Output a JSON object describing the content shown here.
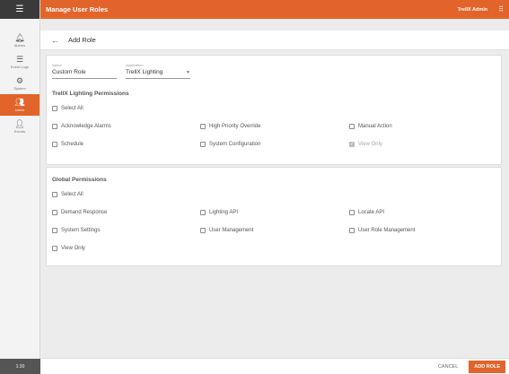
{
  "app": {
    "title": "Manage User Roles",
    "user": "TrellX Admin"
  },
  "sidebar": {
    "items": [
      {
        "label": "Alarms",
        "icon": "bell-icon"
      },
      {
        "label": "Event Logs",
        "icon": "list-icon"
      },
      {
        "label": "System",
        "icon": "gear-icon"
      },
      {
        "label": "Users",
        "icon": "users-icon"
      },
      {
        "label": "Events",
        "icon": "user-upload-icon"
      }
    ],
    "time": "1:30"
  },
  "page": {
    "back_icon": "←",
    "title": "Add Role"
  },
  "form": {
    "name": {
      "label": "Name",
      "value": "Custom Role"
    },
    "application": {
      "label": "Application",
      "value": "TrellX Lighting"
    }
  },
  "trellx_permissions": {
    "title": "TrellX Lighting Permissions",
    "select_all": "Select All",
    "items": [
      "Acknowledge Alarms",
      "High Priority Override",
      "Manual Action",
      "Schedule",
      "System Configuration",
      "View Only"
    ]
  },
  "global_permissions": {
    "title": "Global Permissions",
    "select_all": "Select All",
    "items": [
      "Demand Response",
      "Lighting API",
      "Locate API",
      "System Settings",
      "User Management",
      "User Role Management",
      "View Only"
    ]
  },
  "footer": {
    "cancel": "CANCEL",
    "add": "ADD ROLE"
  }
}
